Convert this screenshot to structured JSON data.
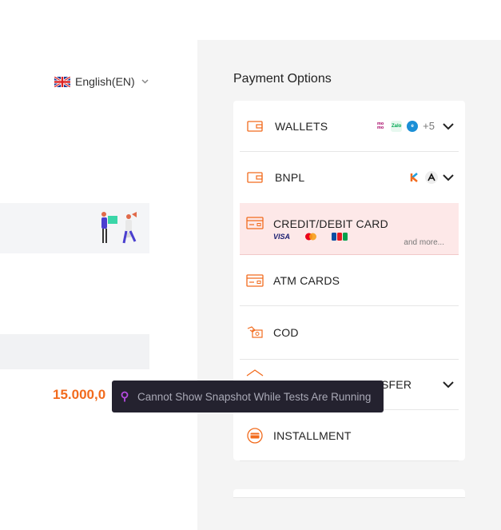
{
  "language": {
    "label": "English(EN)"
  },
  "order": {
    "amount": "15.000,0"
  },
  "payment": {
    "title": "Payment Options",
    "options": [
      {
        "label": "WALLETS",
        "extra": "+5"
      },
      {
        "label": "BNPL"
      },
      {
        "label": "CREDIT/DEBIT CARD",
        "more": "and more..."
      },
      {
        "label": "ATM CARDS"
      },
      {
        "label": "COD"
      },
      {
        "label": "SFER"
      },
      {
        "label": "INSTALLMENT"
      }
    ],
    "wallet_icons": [
      "momo",
      "Zalo Pay",
      "eWallet"
    ],
    "card_brands": [
      "VISA",
      "Mastercard",
      "JCB"
    ]
  },
  "tooltip": {
    "text": "Cannot Show Snapshot While Tests Are Running"
  },
  "colors": {
    "accent": "#f26b1d",
    "selected_bg": "#fde8e8",
    "tooltip_bg": "#24222f"
  }
}
